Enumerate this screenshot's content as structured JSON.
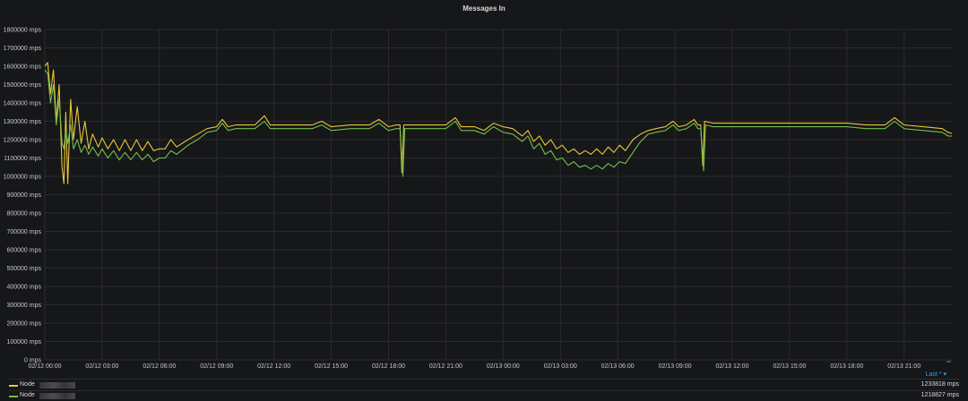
{
  "panel": {
    "title": "Messages In"
  },
  "legend": {
    "header": "Last *",
    "header_arrow": "▾",
    "items": [
      {
        "name": "Node",
        "value": "1233818 mps",
        "color": "#e8c43a"
      },
      {
        "name": "Node",
        "value": "1218827 mps",
        "color": "#73bf4d"
      }
    ]
  },
  "chart_data": {
    "type": "line",
    "title": "Messages In",
    "unit": "mps",
    "ylim": [
      0,
      1800000
    ],
    "yticks": [
      "0 mps",
      "100000 mps",
      "200000 mps",
      "300000 mps",
      "400000 mps",
      "500000 mps",
      "600000 mps",
      "700000 mps",
      "800000 mps",
      "900000 mps",
      "1000000 mps",
      "1100000 mps",
      "1200000 mps",
      "1300000 mps",
      "1400000 mps",
      "1500000 mps",
      "1600000 mps",
      "1700000 mps",
      "1800000 mps"
    ],
    "xticks": [
      "02/12 00:00",
      "02/12 03:00",
      "02/12 06:00",
      "02/12 09:00",
      "02/12 12:00",
      "02/12 15:00",
      "02/12 18:00",
      "02/12 21:00",
      "02/13 00:00",
      "02/13 03:00",
      "02/13 06:00",
      "02/13 09:00",
      "02/13 12:00",
      "02/13 15:00",
      "02/13 18:00",
      "02/13 21:00"
    ],
    "x_range_hours": [
      0,
      47.5
    ],
    "grid": true,
    "legend_position": "bottom",
    "series": [
      {
        "color": "#e8c43a",
        "points": [
          [
            0,
            1600000
          ],
          [
            0.15,
            1620000
          ],
          [
            0.3,
            1450000
          ],
          [
            0.45,
            1580000
          ],
          [
            0.6,
            1300000
          ],
          [
            0.75,
            1500000
          ],
          [
            0.9,
            1050000
          ],
          [
            1.0,
            960000
          ],
          [
            1.1,
            1350000
          ],
          [
            1.2,
            960000
          ],
          [
            1.35,
            1420000
          ],
          [
            1.5,
            1200000
          ],
          [
            1.7,
            1380000
          ],
          [
            1.9,
            1180000
          ],
          [
            2.1,
            1300000
          ],
          [
            2.3,
            1150000
          ],
          [
            2.5,
            1230000
          ],
          [
            2.8,
            1160000
          ],
          [
            3.0,
            1210000
          ],
          [
            3.3,
            1150000
          ],
          [
            3.6,
            1200000
          ],
          [
            3.9,
            1140000
          ],
          [
            4.2,
            1200000
          ],
          [
            4.5,
            1140000
          ],
          [
            4.8,
            1200000
          ],
          [
            5.1,
            1140000
          ],
          [
            5.4,
            1190000
          ],
          [
            5.7,
            1140000
          ],
          [
            6.0,
            1150000
          ],
          [
            6.3,
            1150000
          ],
          [
            6.6,
            1200000
          ],
          [
            6.9,
            1160000
          ],
          [
            7.5,
            1200000
          ],
          [
            8.0,
            1230000
          ],
          [
            8.5,
            1260000
          ],
          [
            9.0,
            1270000
          ],
          [
            9.3,
            1310000
          ],
          [
            9.6,
            1270000
          ],
          [
            10.0,
            1280000
          ],
          [
            11.0,
            1280000
          ],
          [
            11.5,
            1330000
          ],
          [
            11.8,
            1280000
          ],
          [
            12.5,
            1280000
          ],
          [
            13.0,
            1280000
          ],
          [
            14.0,
            1280000
          ],
          [
            14.5,
            1300000
          ],
          [
            15.0,
            1270000
          ],
          [
            16.0,
            1280000
          ],
          [
            17.0,
            1280000
          ],
          [
            17.5,
            1310000
          ],
          [
            18.0,
            1270000
          ],
          [
            18.4,
            1280000
          ],
          [
            18.6,
            1280000
          ],
          [
            18.7,
            1020000
          ],
          [
            18.8,
            1280000
          ],
          [
            19.0,
            1280000
          ],
          [
            20.0,
            1280000
          ],
          [
            21.0,
            1280000
          ],
          [
            21.5,
            1320000
          ],
          [
            21.8,
            1270000
          ],
          [
            22.5,
            1270000
          ],
          [
            23.0,
            1250000
          ],
          [
            23.5,
            1290000
          ],
          [
            24.0,
            1270000
          ],
          [
            24.5,
            1260000
          ],
          [
            25.0,
            1220000
          ],
          [
            25.3,
            1250000
          ],
          [
            25.6,
            1190000
          ],
          [
            25.9,
            1220000
          ],
          [
            26.2,
            1170000
          ],
          [
            26.5,
            1200000
          ],
          [
            26.8,
            1150000
          ],
          [
            27.1,
            1170000
          ],
          [
            27.4,
            1130000
          ],
          [
            27.7,
            1150000
          ],
          [
            28.0,
            1120000
          ],
          [
            28.3,
            1140000
          ],
          [
            28.6,
            1120000
          ],
          [
            28.9,
            1150000
          ],
          [
            29.2,
            1120000
          ],
          [
            29.5,
            1160000
          ],
          [
            29.8,
            1130000
          ],
          [
            30.1,
            1170000
          ],
          [
            30.4,
            1140000
          ],
          [
            30.8,
            1200000
          ],
          [
            31.2,
            1230000
          ],
          [
            31.6,
            1250000
          ],
          [
            32.0,
            1260000
          ],
          [
            32.5,
            1270000
          ],
          [
            32.9,
            1300000
          ],
          [
            33.2,
            1270000
          ],
          [
            33.6,
            1280000
          ],
          [
            34.0,
            1310000
          ],
          [
            34.2,
            1280000
          ],
          [
            34.35,
            1280000
          ],
          [
            34.45,
            1060000
          ],
          [
            34.55,
            1300000
          ],
          [
            35.0,
            1290000
          ],
          [
            36.0,
            1290000
          ],
          [
            37.0,
            1290000
          ],
          [
            38.0,
            1290000
          ],
          [
            39.0,
            1290000
          ],
          [
            40.0,
            1290000
          ],
          [
            41.0,
            1290000
          ],
          [
            42.0,
            1290000
          ],
          [
            43.0,
            1280000
          ],
          [
            44.0,
            1280000
          ],
          [
            44.5,
            1320000
          ],
          [
            45.0,
            1280000
          ],
          [
            46.0,
            1270000
          ],
          [
            47.0,
            1260000
          ],
          [
            47.3,
            1240000
          ],
          [
            47.5,
            1233818
          ]
        ]
      },
      {
        "color": "#73bf4d",
        "points": [
          [
            0,
            1580000
          ],
          [
            0.15,
            1560000
          ],
          [
            0.3,
            1400000
          ],
          [
            0.45,
            1500000
          ],
          [
            0.6,
            1280000
          ],
          [
            0.75,
            1420000
          ],
          [
            0.9,
            1180000
          ],
          [
            1.0,
            1150000
          ],
          [
            1.1,
            1250000
          ],
          [
            1.2,
            1180000
          ],
          [
            1.35,
            1280000
          ],
          [
            1.5,
            1150000
          ],
          [
            1.7,
            1200000
          ],
          [
            1.9,
            1130000
          ],
          [
            2.1,
            1170000
          ],
          [
            2.3,
            1120000
          ],
          [
            2.5,
            1160000
          ],
          [
            2.8,
            1110000
          ],
          [
            3.0,
            1150000
          ],
          [
            3.3,
            1100000
          ],
          [
            3.6,
            1140000
          ],
          [
            3.9,
            1090000
          ],
          [
            4.2,
            1130000
          ],
          [
            4.5,
            1090000
          ],
          [
            4.8,
            1130000
          ],
          [
            5.1,
            1090000
          ],
          [
            5.4,
            1120000
          ],
          [
            5.7,
            1080000
          ],
          [
            6.0,
            1100000
          ],
          [
            6.3,
            1100000
          ],
          [
            6.6,
            1140000
          ],
          [
            6.9,
            1120000
          ],
          [
            7.5,
            1170000
          ],
          [
            8.0,
            1200000
          ],
          [
            8.5,
            1240000
          ],
          [
            9.0,
            1250000
          ],
          [
            9.3,
            1290000
          ],
          [
            9.6,
            1250000
          ],
          [
            10.0,
            1260000
          ],
          [
            11.0,
            1260000
          ],
          [
            11.5,
            1300000
          ],
          [
            11.8,
            1260000
          ],
          [
            12.5,
            1260000
          ],
          [
            13.0,
            1260000
          ],
          [
            14.0,
            1260000
          ],
          [
            14.5,
            1280000
          ],
          [
            15.0,
            1250000
          ],
          [
            16.0,
            1260000
          ],
          [
            17.0,
            1260000
          ],
          [
            17.5,
            1290000
          ],
          [
            18.0,
            1250000
          ],
          [
            18.4,
            1260000
          ],
          [
            18.6,
            1260000
          ],
          [
            18.75,
            1000000
          ],
          [
            18.85,
            1260000
          ],
          [
            19.0,
            1260000
          ],
          [
            20.0,
            1260000
          ],
          [
            21.0,
            1260000
          ],
          [
            21.5,
            1300000
          ],
          [
            21.8,
            1250000
          ],
          [
            22.5,
            1250000
          ],
          [
            23.0,
            1230000
          ],
          [
            23.5,
            1270000
          ],
          [
            24.0,
            1240000
          ],
          [
            24.5,
            1230000
          ],
          [
            25.0,
            1190000
          ],
          [
            25.3,
            1220000
          ],
          [
            25.6,
            1150000
          ],
          [
            25.9,
            1180000
          ],
          [
            26.2,
            1120000
          ],
          [
            26.5,
            1140000
          ],
          [
            26.8,
            1090000
          ],
          [
            27.1,
            1100000
          ],
          [
            27.4,
            1060000
          ],
          [
            27.7,
            1080000
          ],
          [
            28.0,
            1050000
          ],
          [
            28.3,
            1060000
          ],
          [
            28.6,
            1040000
          ],
          [
            28.9,
            1060000
          ],
          [
            29.2,
            1040000
          ],
          [
            29.5,
            1070000
          ],
          [
            29.8,
            1050000
          ],
          [
            30.1,
            1080000
          ],
          [
            30.4,
            1070000
          ],
          [
            30.8,
            1130000
          ],
          [
            31.2,
            1190000
          ],
          [
            31.6,
            1230000
          ],
          [
            32.0,
            1240000
          ],
          [
            32.5,
            1250000
          ],
          [
            32.9,
            1280000
          ],
          [
            33.2,
            1250000
          ],
          [
            33.6,
            1260000
          ],
          [
            34.0,
            1290000
          ],
          [
            34.2,
            1260000
          ],
          [
            34.35,
            1260000
          ],
          [
            34.5,
            1030000
          ],
          [
            34.6,
            1280000
          ],
          [
            35.0,
            1270000
          ],
          [
            36.0,
            1270000
          ],
          [
            37.0,
            1270000
          ],
          [
            38.0,
            1270000
          ],
          [
            39.0,
            1270000
          ],
          [
            40.0,
            1270000
          ],
          [
            41.0,
            1270000
          ],
          [
            42.0,
            1270000
          ],
          [
            43.0,
            1260000
          ],
          [
            44.0,
            1260000
          ],
          [
            44.5,
            1300000
          ],
          [
            45.0,
            1260000
          ],
          [
            46.0,
            1250000
          ],
          [
            47.0,
            1240000
          ],
          [
            47.3,
            1220000
          ],
          [
            47.5,
            1218827
          ]
        ]
      }
    ]
  }
}
